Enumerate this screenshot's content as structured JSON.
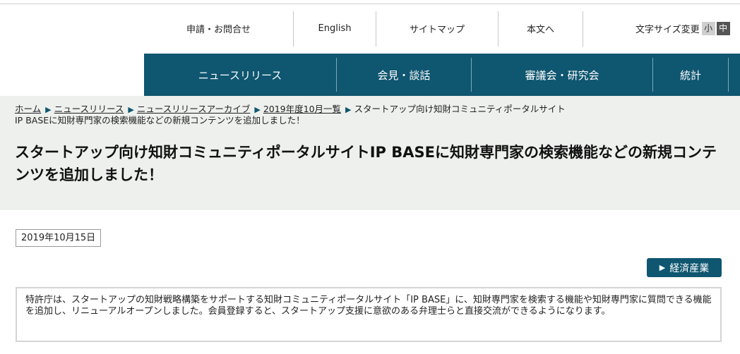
{
  "utility_nav": {
    "contact": "申請・お問合せ",
    "english": "English",
    "sitemap": "サイトマップ",
    "skip_to_content": "本文へ",
    "font_size_label": "文字サイズ変更",
    "font_size_small": "小",
    "font_size_medium": "中"
  },
  "main_nav": {
    "items": [
      "ニュースリリース",
      "会見・談話",
      "審議会・研究会",
      "統計"
    ]
  },
  "breadcrumb": {
    "items": [
      "ホーム",
      "ニュースリリース",
      "ニュースリリースアーカイブ",
      "2019年度10月一覧"
    ],
    "current_line1": "スタートアップ向け知財コミュニティポータルサイト",
    "current_line2": "IP BASEに知財専門家の検索機能などの新規コンテンツを追加しました！"
  },
  "article": {
    "title": "スタートアップ向け知財コミュニティポータルサイトIP BASEに知財専門家の検索機能などの新規コンテンツを追加しました！",
    "date": "2019年10月15日",
    "ministry_label": "経済産業",
    "summary": "特許庁は、スタートアップの知財戦略構築をサポートする知財コミュニティポータルサイト「IP BASE」に、知財専門家を検索する機能や知財専門家に質問できる機能を追加し、リニューアルオープンしました。会員登録すると、スタートアップ支援に意欲のある弁理士らと直接交流ができるようになります。"
  },
  "colors": {
    "nav_bg": "#0f5670",
    "title_area_bg": "#eef0ee"
  }
}
